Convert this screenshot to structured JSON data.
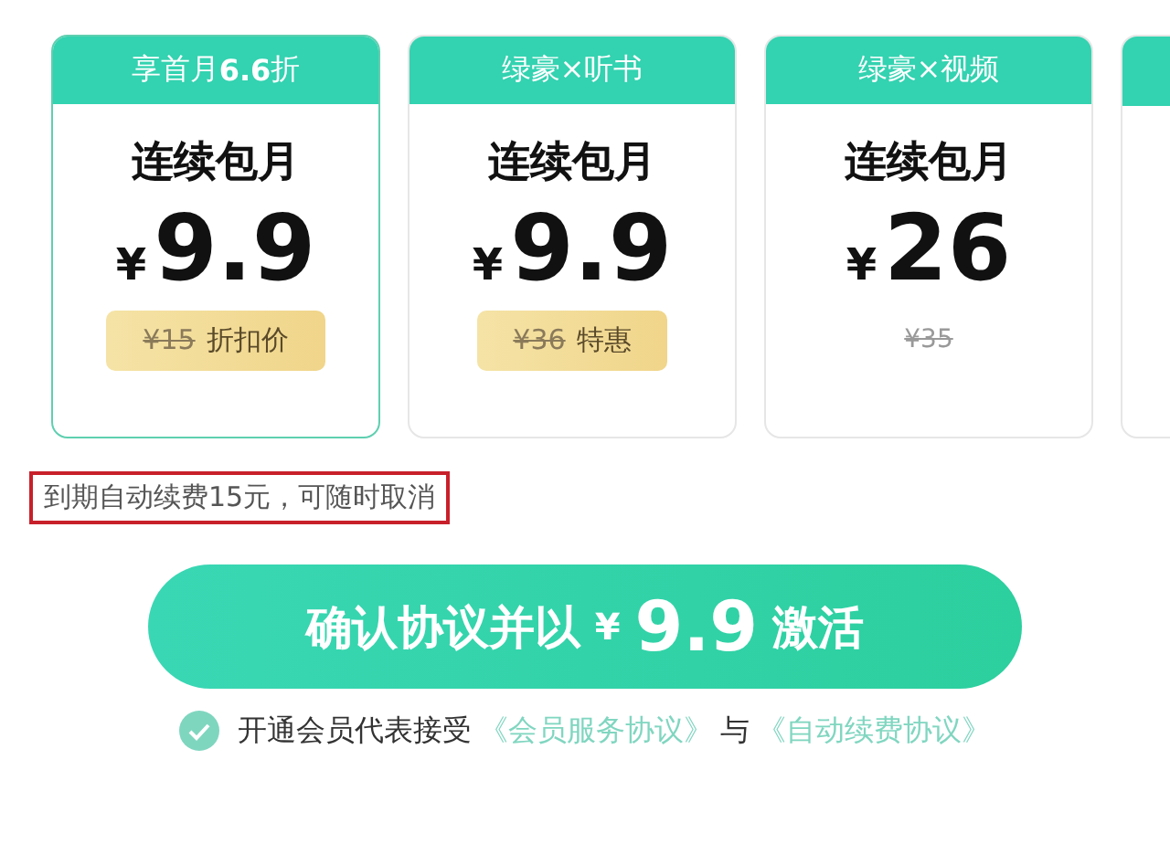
{
  "plans": [
    {
      "header": "享首月**6.6**折",
      "name": "连续包月",
      "currency": "¥",
      "price": "9.9",
      "original_price": "¥15",
      "tag": "折扣价",
      "kind": "tag",
      "selected": true
    },
    {
      "header": "绿豪×听书",
      "name": "连续包月",
      "currency": "¥",
      "price": "9.9",
      "original_price": "¥36",
      "tag": "特惠",
      "kind": "tag",
      "selected": false
    },
    {
      "header": "绿豪×视频",
      "name": "连续包月",
      "currency": "¥",
      "price": "26",
      "original_price": "¥35",
      "kind": "plain",
      "selected": false
    }
  ],
  "notice": {
    "text": "到期自动续费15元，可随时取消",
    "highlighted": true
  },
  "confirm_button": {
    "prefix": "确认协议并以",
    "currency": "¥",
    "amount": "9.9",
    "suffix": "激活"
  },
  "agreement": {
    "checked": true,
    "text": "开通会员代表接受",
    "links": [
      "《会员服务协议》",
      "《自动续费协议》"
    ],
    "joiner": "与"
  }
}
